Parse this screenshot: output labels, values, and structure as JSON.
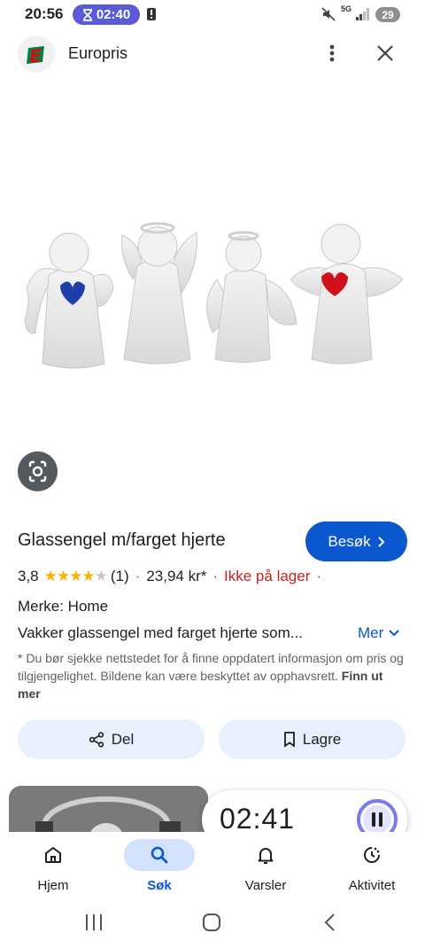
{
  "status_bar": {
    "time": "20:56",
    "timer": "02:40",
    "network": "5G",
    "battery": "29"
  },
  "header": {
    "site_name": "Europris",
    "logo_icon": "europris-logo",
    "menu_icon": "more-vert-icon",
    "close_icon": "close-icon"
  },
  "image": {
    "description_icon": "glass-angels-photo"
  },
  "product": {
    "title": "Glassengel m/farget hjerte",
    "visit_label": "Besøk",
    "rating": "3,8",
    "rating_value": 3.8,
    "reviews": "(1)",
    "price": "23,94 kr*",
    "stock": "Ikke på lager",
    "brand": "Merke: Home",
    "description": "Vakker glassengel med farget hjerte som...",
    "more_label": "Mer",
    "disclaimer": "* Du bør sjekke nettstedet for å finne oppdatert informasjon om pris og tilgjengelighet. Bildene kan være beskyttet av opphavsrett.",
    "disclaimer_link": "Finn ut mer"
  },
  "actions": {
    "share_label": "Del",
    "save_label": "Lagre"
  },
  "floating_timer": {
    "time": "02:41"
  },
  "bottom_nav": {
    "items": [
      {
        "label": "Hjem",
        "icon": "home-icon",
        "active": false
      },
      {
        "label": "Søk",
        "icon": "search-icon",
        "active": true
      },
      {
        "label": "Varsler",
        "icon": "bell-icon",
        "active": false
      },
      {
        "label": "Aktivitet",
        "icon": "activity-icon",
        "active": false
      }
    ]
  },
  "colors": {
    "accent": "#0b57d0",
    "stock_red": "#c5221f",
    "star": "#f4b400",
    "timer_pill": "#5b5bd6"
  }
}
